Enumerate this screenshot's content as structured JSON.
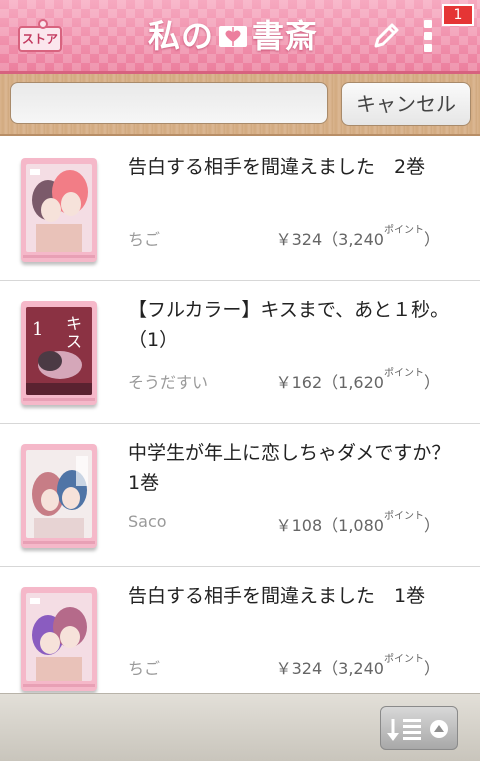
{
  "header": {
    "store_label": "ストア",
    "title_part1": "私の",
    "title_part2": "書斎",
    "badge_count": "1"
  },
  "search": {
    "value": "",
    "cancel_label": "キャンセル"
  },
  "books": [
    {
      "title": "告白する相手を間違えました　2巻",
      "author": "ちご",
      "price": "￥324（3,240",
      "points_unit": "ポイント",
      "price_close": "）",
      "cover_colors": [
        "#c98aa0",
        "#f27d86",
        "#e9c2b9"
      ]
    },
    {
      "title": "【フルカラー】キスまで、あと１秒。（1）",
      "author": "そうだすい",
      "price": "￥162（1,620",
      "points_unit": "ポイント",
      "price_close": "）",
      "cover_colors": [
        "#7a2b3a",
        "#d5a7b9",
        "#4b3a44"
      ]
    },
    {
      "title": "中学生が年上に恋しちゃダメですか？　1巻",
      "author": "Saco",
      "price": "￥108（1,080",
      "points_unit": "ポイント",
      "price_close": "）",
      "cover_colors": [
        "#e9dede",
        "#4f74a6",
        "#c77d86"
      ]
    },
    {
      "title": "告白する相手を間違えました　1巻",
      "author": "ちご",
      "price": "￥324（3,240",
      "points_unit": "ポイント",
      "price_close": "）",
      "cover_colors": [
        "#b56a8a",
        "#8a5cc0",
        "#e9c2b9"
      ]
    }
  ],
  "icons": {
    "search": "search-icon",
    "edit": "pencil-icon",
    "menu": "more-vert-icon",
    "sort": "sort-list-icon"
  },
  "colors": {
    "header_pink": "#ec7f9e",
    "badge_red": "#e53535",
    "wood": "#d2aa80"
  }
}
